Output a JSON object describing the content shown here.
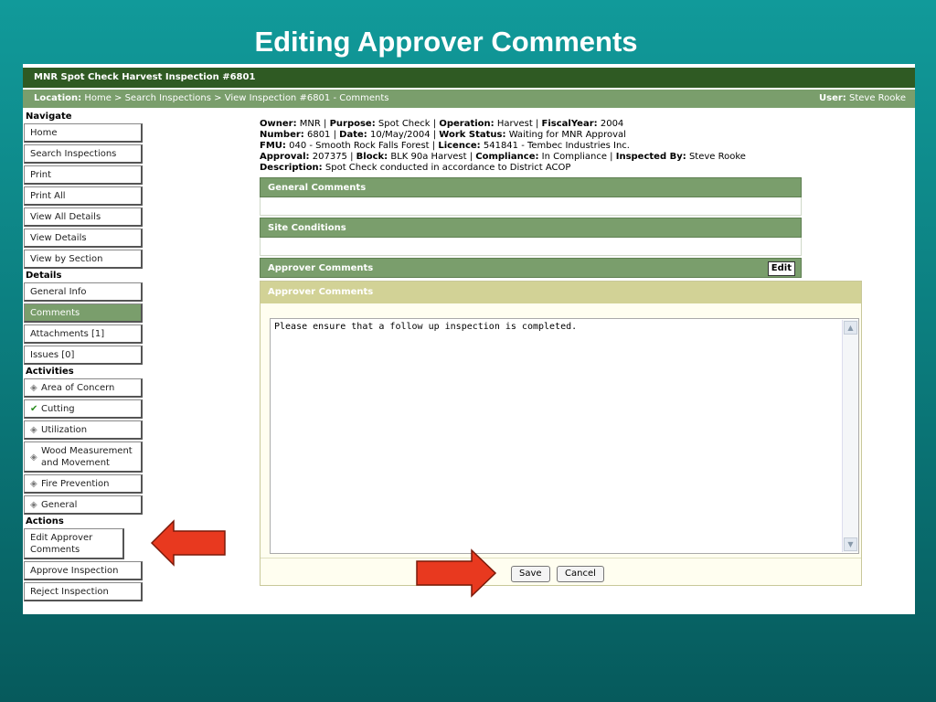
{
  "slide_title": "Editing Approver Comments",
  "app": {
    "window_title": "MNR Spot Check Harvest Inspection #6801",
    "location_label": "Location:",
    "location_path": "Home > Search Inspections > View Inspection #6801 - Comments",
    "user_label": "User:",
    "user_name": "Steve Rooke"
  },
  "nav": {
    "navigate_heading": "Navigate",
    "navigate_items": [
      "Home",
      "Search Inspections",
      "Print",
      "Print All",
      "View All Details",
      "View Details",
      "View by Section"
    ],
    "details_heading": "Details",
    "details_items": [
      "General Info",
      "Comments",
      "Attachments [1]",
      "Issues [0]"
    ],
    "activities_heading": "Activities",
    "activities_items": [
      "Area of Concern",
      "Cutting",
      "Utilization",
      "Wood Measurement and Movement",
      "Fire Prevention",
      "General"
    ],
    "actions_heading": "Actions",
    "actions_items": [
      "Edit Approver Comments",
      "Approve Inspection",
      "Reject Inspection"
    ]
  },
  "info": {
    "owner_label": "Owner:",
    "owner": "MNR",
    "purpose_label": "Purpose:",
    "purpose": "Spot Check",
    "operation_label": "Operation:",
    "operation": "Harvest",
    "fiscal_label": "FiscalYear:",
    "fiscal": "2004",
    "number_label": "Number:",
    "number": "6801",
    "date_label": "Date:",
    "date": "10/May/2004",
    "work_status_label": "Work Status:",
    "work_status": "Waiting for MNR Approval",
    "fmu_label": "FMU:",
    "fmu": "040 - Smooth Rock Falls Forest",
    "licence_label": "Licence:",
    "licence": "541841 - Tembec Industries Inc.",
    "approval_label": "Approval:",
    "approval": "207375",
    "block_label": "Block:",
    "block": "BLK 90a Harvest",
    "compliance_label": "Compliance:",
    "compliance": "In Compliance",
    "inspected_label": "Inspected By:",
    "inspected": "Steve Rooke",
    "description_label": "Description:",
    "description": "Spot Check conducted in accordance to District ACOP"
  },
  "panels": {
    "general_comments": "General Comments",
    "site_conditions": "Site Conditions",
    "approver_comments": "Approver Comments",
    "edit_label": "Edit"
  },
  "dialog": {
    "title": "Approver Comments",
    "text": "Please ensure that a follow up inspection is completed.",
    "save_label": "Save",
    "cancel_label": "Cancel"
  },
  "colors": {
    "topbar": "#2f5a23",
    "bar_green": "#7a9e6c",
    "dialog_header": "#d2d296",
    "arrow_red": "#e8391f"
  }
}
